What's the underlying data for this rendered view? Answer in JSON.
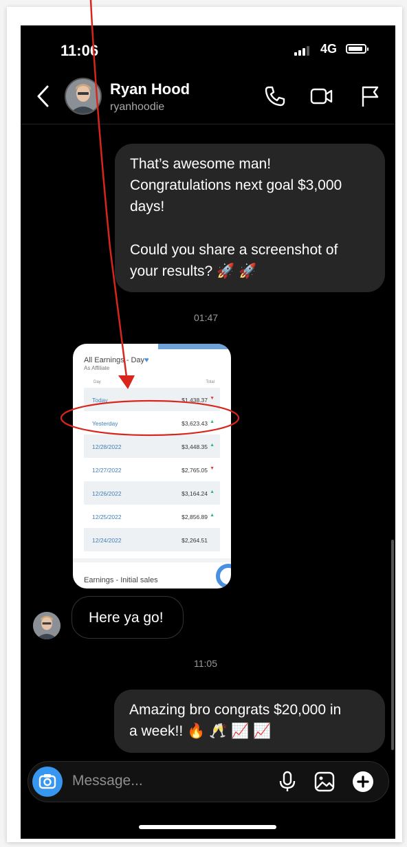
{
  "status": {
    "time": "11:06",
    "network": "4G"
  },
  "contact": {
    "name": "Ryan Hood",
    "handle": "ryanhoodie"
  },
  "messages": {
    "sent_1": {
      "line1": "That’s awesome man!",
      "line2": "Congratulations next goal $3,000",
      "line3": "days!",
      "line4": "Could you share a screenshot of",
      "line5": "your results? 🚀 🚀"
    },
    "timestamp_1": "01:47",
    "shared_image": {
      "title": "All Earnings - Day",
      "subtitle": "As Affiliate",
      "col_day": "Day",
      "col_total": "Total",
      "rows": [
        {
          "date": "Today",
          "value": "$1,438.37",
          "trend": "down"
        },
        {
          "date": "Yesterday",
          "value": "$3,623.43",
          "trend": "up"
        },
        {
          "date": "12/28/2022",
          "value": "$3,448.35",
          "trend": "up"
        },
        {
          "date": "12/27/2022",
          "value": "$2,765.05",
          "trend": "down"
        },
        {
          "date": "12/26/2022",
          "value": "$3,164.24",
          "trend": "up"
        },
        {
          "date": "12/25/2022",
          "value": "$2,856.89",
          "trend": "up"
        },
        {
          "date": "12/24/2022",
          "value": "$2,264.51",
          "trend": "none"
        }
      ],
      "footer": "Earnings - Initial sales"
    },
    "received_1": "Here ya go!",
    "timestamp_2": "11:05",
    "sent_2": {
      "line1": "Amazing bro congrats $20,000 in",
      "line2": "a week!! 🔥 🥂 📈 📈"
    }
  },
  "composer": {
    "placeholder": "Message..."
  },
  "icons": {
    "back": "chevron-left-icon",
    "call": "phone-icon",
    "video": "video-camera-icon",
    "report": "flag-icon",
    "camera": "camera-icon",
    "mic": "microphone-icon",
    "gallery": "image-icon",
    "add": "plus-circle-icon"
  },
  "colors": {
    "background": "#000000",
    "bubble": "#262626",
    "accent": "#3797f0",
    "annotation": "#d8261c"
  }
}
